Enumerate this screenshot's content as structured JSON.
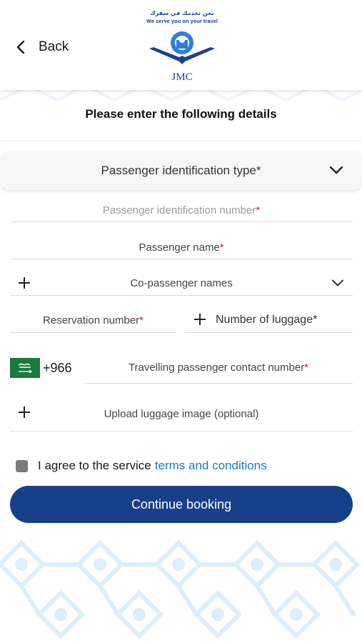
{
  "header": {
    "back_label": "Back",
    "logo": {
      "tagline_ar": "نحن نخدمك في سفرك",
      "tagline_en": "We serve you on your travel",
      "brand": "JMC"
    }
  },
  "form": {
    "title": "Please enter the following details",
    "id_type": {
      "label": "Passenger identification type*"
    },
    "id_number": {
      "label": "Passenger identification number",
      "required_mark": "*"
    },
    "passenger_name": {
      "label": "Passenger name",
      "required_mark": "*"
    },
    "co_passengers": {
      "label": "Co-passenger names"
    },
    "reservation_number": {
      "label": "Reservation number",
      "required_mark": "*"
    },
    "luggage_count": {
      "label": "Number of luggage*"
    },
    "contact": {
      "country_code": "+966",
      "label": "Travelling passenger contact number",
      "required_mark": "*"
    },
    "luggage_image": {
      "label": "Upload luggage image (optional)"
    },
    "agree": {
      "text": "I agree to the service",
      "link": "terms and conditions"
    },
    "continue_label": "Continue booking"
  },
  "colors": {
    "primary": "#17408b",
    "link": "#1a7ac8",
    "required": "#d32020",
    "pattern": "#dbeef9"
  }
}
